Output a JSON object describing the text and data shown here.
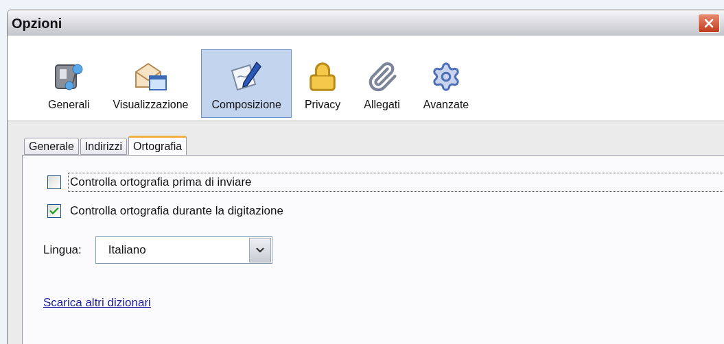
{
  "window": {
    "title": "Opzioni"
  },
  "toolbar": [
    {
      "label": "Generali",
      "selected": false
    },
    {
      "label": "Visualizzazione",
      "selected": false
    },
    {
      "label": "Composizione",
      "selected": true
    },
    {
      "label": "Privacy",
      "selected": false
    },
    {
      "label": "Allegati",
      "selected": false
    },
    {
      "label": "Avanzate",
      "selected": false
    }
  ],
  "tabs": [
    {
      "label": "Generale",
      "selected": false
    },
    {
      "label": "Indirizzi",
      "selected": false
    },
    {
      "label": "Ortografia",
      "selected": true
    }
  ],
  "options": [
    {
      "label": "Controlla ortografia prima di inviare",
      "checked": false,
      "focused": true
    },
    {
      "label": "Controlla ortografia durante la digitazione",
      "checked": true,
      "focused": false
    }
  ],
  "language": {
    "label": "Lingua:",
    "value": "Italiano"
  },
  "link": "Scarica altri dizionari"
}
